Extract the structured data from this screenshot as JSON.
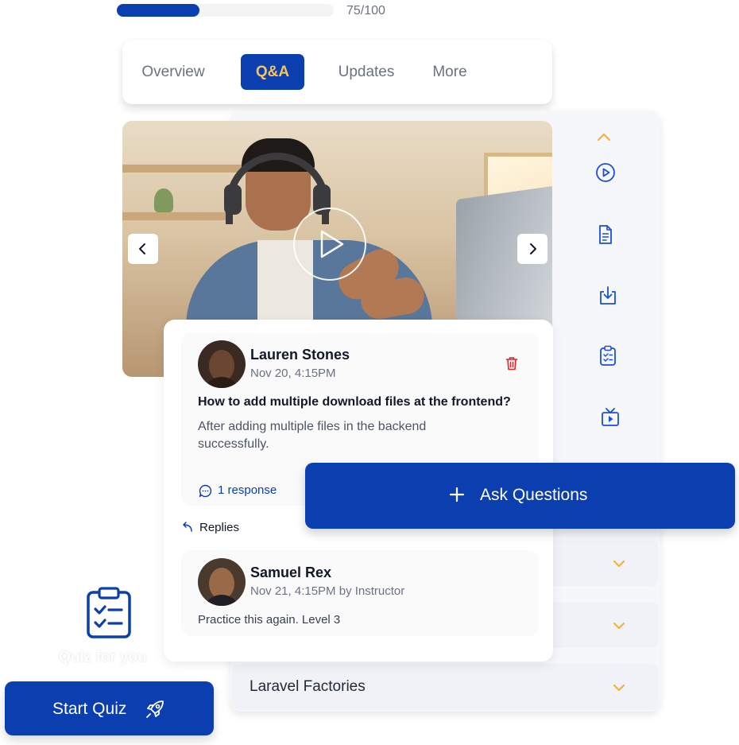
{
  "progress": {
    "value": 75,
    "max": 100,
    "label": "75/100",
    "fill_color": "#0b3fb0"
  },
  "tabs": [
    {
      "label": "Overview",
      "active": false
    },
    {
      "label": "Q&A",
      "active": true
    },
    {
      "label": "Updates",
      "active": false
    },
    {
      "label": "More",
      "active": false
    }
  ],
  "sidebar": {
    "icons": [
      "chevron-up-icon",
      "play-circle-icon",
      "document-icon",
      "download-icon",
      "clipboard-check-icon",
      "tv-play-icon"
    ],
    "accordion": [
      {
        "title": ""
      },
      {
        "title": ""
      },
      {
        "title": "Laravel Factories"
      }
    ]
  },
  "video": {
    "controls": [
      "prev-icon",
      "play-icon",
      "next-icon"
    ]
  },
  "question": {
    "author": "Lauren Stones",
    "meta": "Nov 20, 4:15PM",
    "title": "How to add multiple download files at the frontend?",
    "body": "After adding multiple files in the backend successfully.",
    "responses": "1 response"
  },
  "replies": {
    "label": "Replies",
    "items": [
      {
        "author": "Samuel Rex",
        "meta": "Nov 21, 4:15PM by Instructor",
        "text": "Practice this again. Level 3"
      }
    ]
  },
  "ask_button": {
    "label": "Ask Questions"
  },
  "quiz": {
    "caption": "Quiz for you",
    "button_label": "Start Quiz"
  },
  "colors": {
    "primary": "#0b3fb0",
    "accent": "#f7c458",
    "danger": "#e02424",
    "panel": "#f6f7fb"
  }
}
